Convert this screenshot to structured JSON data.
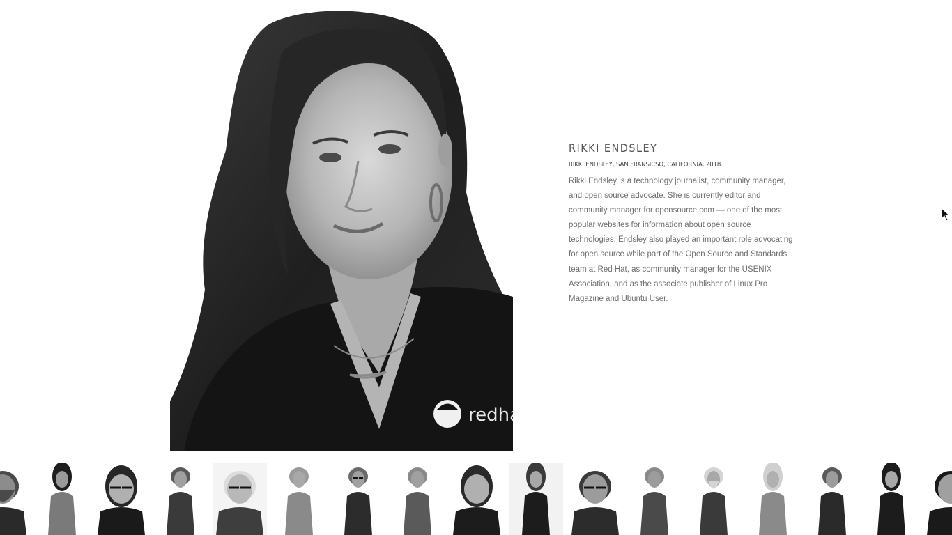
{
  "profile": {
    "name": "RIKKI ENDSLEY",
    "caption": "RIKKI ENDSLEY, SAN FRANSICSO, CALIFORNIA, 2018.",
    "description": "Rikki Endsley is a technology journalist, community manager, and open source advocate. She is currently editor and community manager for opensource.com — one of the most popular websites for information about open source technologies. Endsley also played an important role advocating for open source while part of the Open Source and Standards team at Red Hat, as community manager for the USENIX Association, and as the associate publisher of Linux Pro Magazine and Ubuntu User.",
    "shirt_logo_text": "redhat"
  },
  "gallery": {
    "selected_index": 8,
    "thumbnails": [
      {
        "label": "portrait 1",
        "bg": "#ffffff",
        "shirt": "#2a2a2a",
        "hair": "#4a4a4a",
        "skin": "#8c8c8c",
        "style": "bearded-crop"
      },
      {
        "label": "portrait 2",
        "bg": "#ffffff",
        "shirt": "#7a7a7a",
        "hair": "#1e1e1e",
        "skin": "#9a9a9a",
        "style": "seated-woman"
      },
      {
        "label": "portrait 3",
        "bg": "#ffffff",
        "shirt": "#1a1a1a",
        "hair": "#262626",
        "skin": "#b0b0b0",
        "style": "glasses-woman"
      },
      {
        "label": "portrait 4",
        "bg": "#ffffff",
        "shirt": "#3a3a3a",
        "hair": "#5a5a5a",
        "skin": "#a0a0a0",
        "style": "holding-object"
      },
      {
        "label": "portrait 5",
        "bg": "#f4f4f4",
        "shirt": "#3e3e3e",
        "hair": "#dcdcdc",
        "skin": "#b8b8b8",
        "style": "older-man-glasses"
      },
      {
        "label": "portrait 6",
        "bg": "#ffffff",
        "shirt": "#8a8a8a",
        "hair": "#9a9a9a",
        "skin": "#a8a8a8",
        "style": "man-suit-phone"
      },
      {
        "label": "portrait 7",
        "bg": "#ffffff",
        "shirt": "#2c2c2c",
        "hair": "#6a6a6a",
        "skin": "#a0a0a0",
        "style": "man-glasses-suit"
      },
      {
        "label": "portrait 8",
        "bg": "#ffffff",
        "shirt": "#5a5a5a",
        "hair": "#8a8a8a",
        "skin": "#a0a0a0",
        "style": "man-plaid"
      },
      {
        "label": "portrait 9",
        "bg": "#ffffff",
        "shirt": "#1c1c1c",
        "hair": "#2a2a2a",
        "skin": "#b0b0b0",
        "style": "rikki"
      },
      {
        "label": "portrait 10",
        "bg": "#f2f2f2",
        "shirt": "#1c1c1c",
        "hair": "#3a3a3a",
        "skin": "#a8a8a8",
        "style": "woman-standing"
      },
      {
        "label": "portrait 11",
        "bg": "#ffffff",
        "shirt": "#2c2c2c",
        "hair": "#3a3a3a",
        "skin": "#9c9c9c",
        "style": "man-glasses-closeup"
      },
      {
        "label": "portrait 12",
        "bg": "#ffffff",
        "shirt": "#4a4a4a",
        "hair": "#8a8a8a",
        "skin": "#9c9c9c",
        "style": "man-seated"
      },
      {
        "label": "portrait 13",
        "bg": "#ffffff",
        "shirt": "#3a3a3a",
        "hair": "#d4d4d4",
        "skin": "#a8a8a8",
        "style": "bearded-tattoo"
      },
      {
        "label": "portrait 14",
        "bg": "#ffffff",
        "shirt": "#8a8a8a",
        "hair": "#d0d0d0",
        "skin": "#b0b0b0",
        "style": "blonde-woman"
      },
      {
        "label": "portrait 15",
        "bg": "#ffffff",
        "shirt": "#2a2a2a",
        "hair": "#5a5a5a",
        "skin": "#9c9c9c",
        "style": "man-suit-seated"
      },
      {
        "label": "portrait 16",
        "bg": "#ffffff",
        "shirt": "#1c1c1c",
        "hair": "#1c1c1c",
        "skin": "#a8a8a8",
        "style": "woman-black-dress"
      },
      {
        "label": "portrait 17",
        "bg": "#ffffff",
        "shirt": "#1a1a1a",
        "hair": "#1a1a1a",
        "skin": "#a0a0a0",
        "style": "closeup-crop"
      }
    ]
  }
}
